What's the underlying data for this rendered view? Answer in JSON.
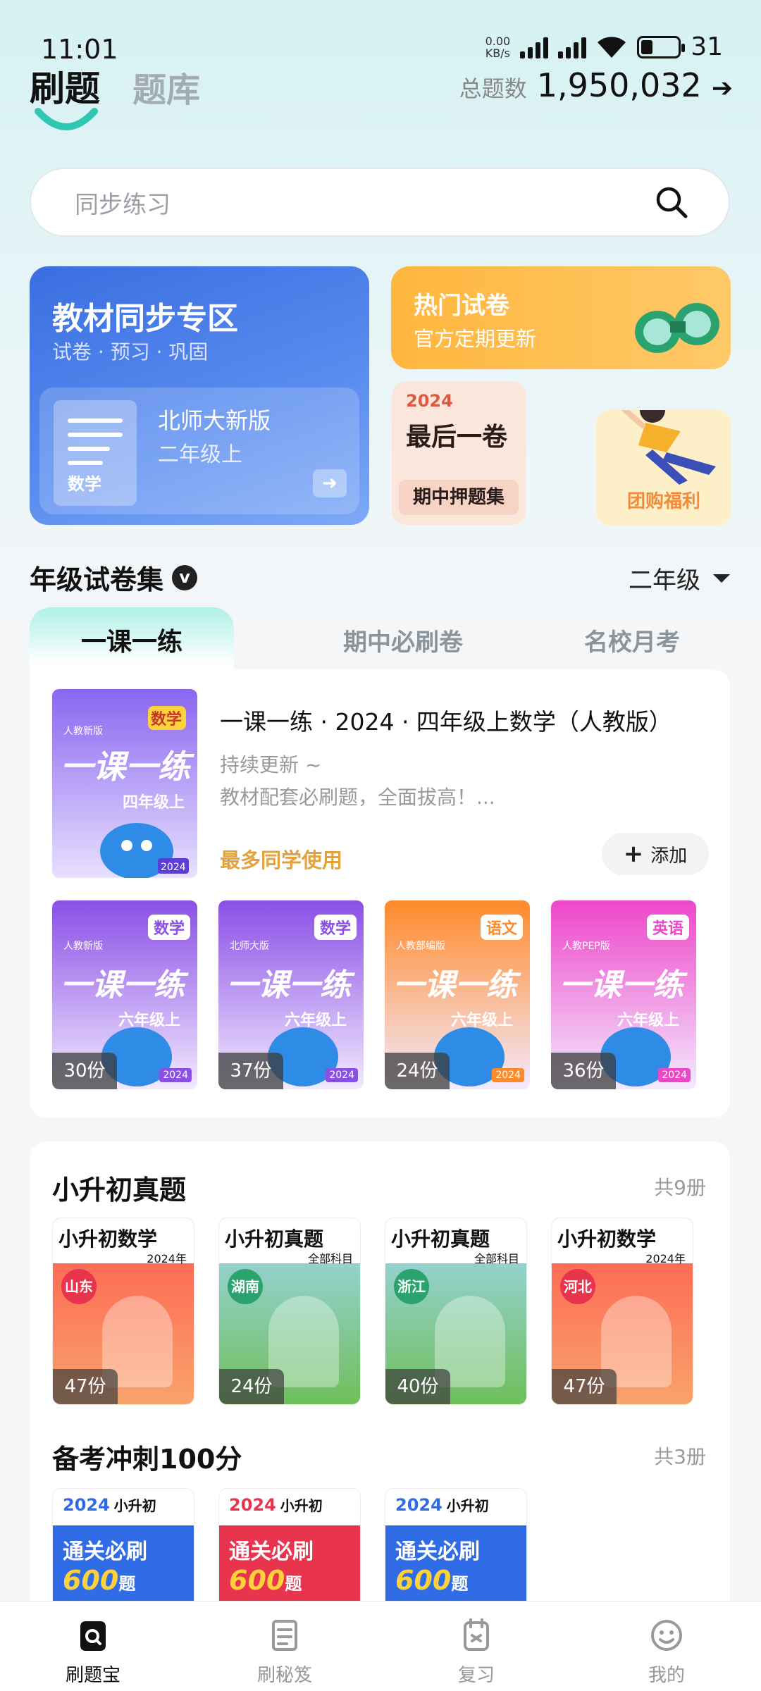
{
  "status_bar": {
    "time": "11:01",
    "speed_value": "0.00",
    "speed_unit": "KB/s",
    "battery": "31",
    "battery_level": 0.31
  },
  "header": {
    "tab_active": "刷题",
    "tab_other": "题库",
    "total_label": "总题数",
    "total_value": "1,950,032",
    "total_arrow": "➔"
  },
  "search": {
    "placeholder": "同步练习"
  },
  "banners": {
    "sync": {
      "title": "教材同步专区",
      "subtitle": "试卷 · 预习 · 巩固",
      "book_label": "数学",
      "edition": "北师大新版",
      "grade": "二年级上"
    },
    "hot": {
      "title": "热门试卷",
      "subtitle": "官方定期更新"
    },
    "last_paper": {
      "year": "2024",
      "title": "最后一卷",
      "ribbon": "期中押题集"
    },
    "group": {
      "label": "团购福利"
    }
  },
  "grade_section": {
    "title": "年级试卷集",
    "badge": "v",
    "grade_selected": "二年级"
  },
  "tabs": [
    {
      "label": "一课一练"
    },
    {
      "label": "期中必刷卷"
    },
    {
      "label": "名校月考"
    }
  ],
  "featured": {
    "title": "一课一练 · 2024 · 四年级上数学（人教版）",
    "sub1": "持续更新 ~",
    "sub2": "教材配套必刷题，全面拔高！...",
    "tag": "最多同学使用",
    "add_label": "添加",
    "add_icon": "plus-icon",
    "cover": {
      "publisher": "人教新版",
      "subject": "数学",
      "series": "一课一练",
      "grade": "四年级上",
      "year": "2024"
    }
  },
  "books": [
    {
      "publisher": "人教新版",
      "subject": "数学",
      "grade": "六年级上",
      "count": "30份",
      "year": "2024",
      "color": "#8a4fe6"
    },
    {
      "publisher": "北师大版",
      "subject": "数学",
      "grade": "六年级上",
      "count": "37份",
      "year": "2024",
      "color": "#8a4fe6"
    },
    {
      "publisher": "人教部编版",
      "subject": "语文",
      "grade": "六年级上",
      "count": "24份",
      "year": "2024",
      "color": "#ff8a2a"
    },
    {
      "publisher": "人教PEP版",
      "subject": "英语",
      "grade": "六年级上",
      "count": "36份",
      "year": "2024",
      "color": "#ee46c9"
    }
  ],
  "xsc": {
    "title": "小升初真题",
    "count": "共9册",
    "items": [
      {
        "title": "小升初数学",
        "sub": "2024年",
        "province": "山东",
        "count": "47份"
      },
      {
        "title": "小升初真题",
        "sub": "全部科目",
        "province": "湖南",
        "count": "24份"
      },
      {
        "title": "小升初真题",
        "sub": "全部科目",
        "province": "浙江",
        "count": "40份"
      },
      {
        "title": "小升初数学",
        "sub": "2024年",
        "province": "河北",
        "count": "47份"
      }
    ]
  },
  "sprint": {
    "title": "备考冲刺100分",
    "count": "共3册",
    "items": [
      {
        "year": "2024",
        "level": "小升初",
        "line1": "通关必刷",
        "line2": "600",
        "unit": "题",
        "color": "#2f6ce6"
      },
      {
        "year": "2024",
        "level": "小升初",
        "line1": "通关必刷",
        "line2": "600",
        "unit": "题",
        "color": "#e8344c"
      },
      {
        "year": "2024",
        "level": "小升初",
        "line1": "通关必刷",
        "line2": "600",
        "unit": "题",
        "color": "#2f6ce6"
      }
    ]
  },
  "nav": [
    {
      "label": "刷题宝",
      "icon": "search-bag-icon"
    },
    {
      "label": "刷秘笈",
      "icon": "scroll-icon"
    },
    {
      "label": "复习",
      "icon": "notebook-icon"
    },
    {
      "label": "我的",
      "icon": "smiley-icon"
    }
  ]
}
